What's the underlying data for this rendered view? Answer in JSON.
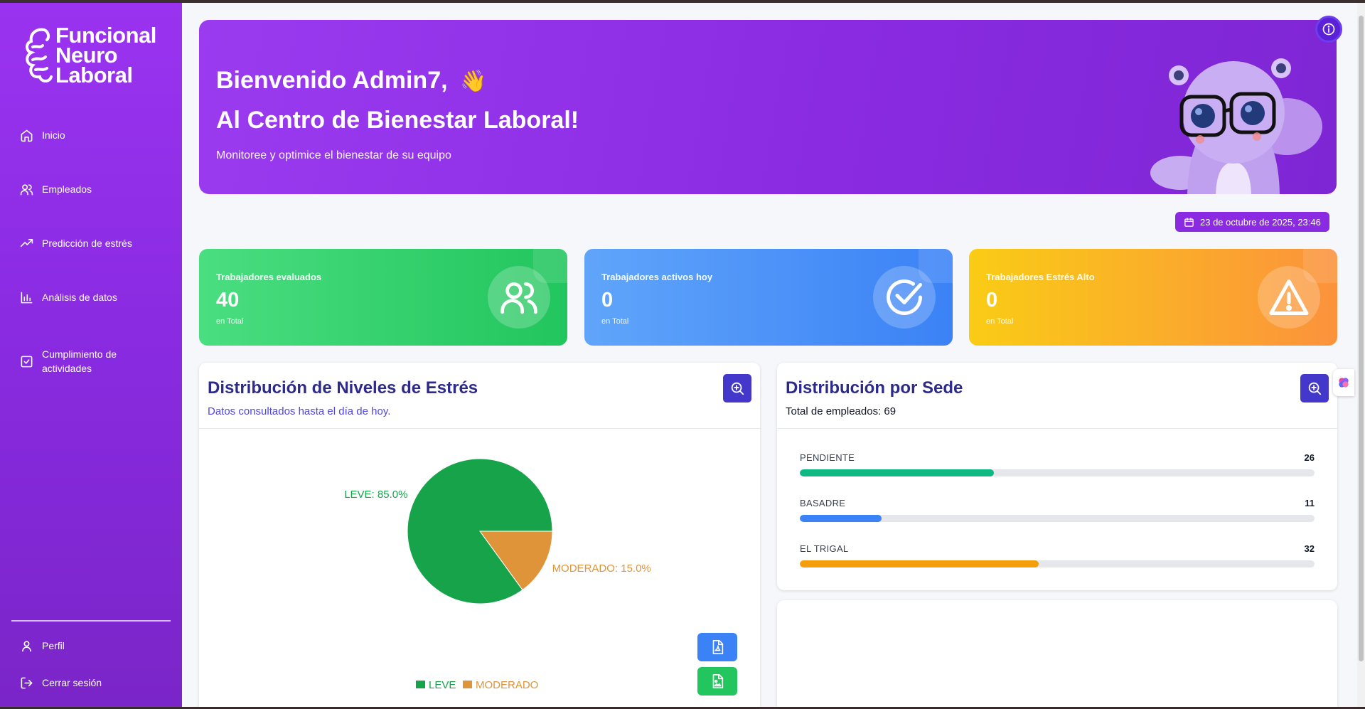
{
  "app": {
    "logo_lines": [
      "Funcional",
      "Neuro",
      "Laboral"
    ]
  },
  "sidebar": {
    "items": [
      {
        "label": "Inicio",
        "icon": "home-icon"
      },
      {
        "label": "Empleados",
        "icon": "users-icon"
      },
      {
        "label": "Predicción de estrés",
        "icon": "trending-up-icon"
      },
      {
        "label": "Análisis de datos",
        "icon": "bar-chart-icon"
      },
      {
        "label": "Cumplimiento de actividades",
        "icon": "check-square-icon"
      }
    ],
    "footer": [
      {
        "label": "Perfil",
        "icon": "user-icon"
      },
      {
        "label": "Cerrar sesión",
        "icon": "logout-icon"
      }
    ]
  },
  "hero": {
    "greeting": "Bienvenido Admin7,",
    "wave": "👋",
    "title": "Al Centro de Bienestar Laboral!",
    "subtitle": "Monitoree y optimice el bienestar de su equipo"
  },
  "date_badge": "23 de octubre de 2025, 23:46",
  "stats": [
    {
      "label": "Trabajadores evaluados",
      "value": "40",
      "caption": "en Total",
      "icon": "users-icon",
      "color": "#22c55e"
    },
    {
      "label": "Trabajadores activos hoy",
      "value": "0",
      "caption": "en Total",
      "icon": "check-circle-icon",
      "color": "#3b82f6"
    },
    {
      "label": "Trabajadores Estrés Alto",
      "value": "0",
      "caption": "en Total",
      "icon": "warning-icon",
      "color": "#fb923c"
    }
  ],
  "stress_card": {
    "title": "Distribución de Niveles de Estrés",
    "subtitle": "Datos consultados hasta el día de hoy."
  },
  "chart_data": {
    "type": "pie",
    "categories": [
      "LEVE",
      "MODERADO"
    ],
    "values": [
      85.0,
      15.0
    ],
    "slice_labels": [
      "LEVE: 85.0%",
      "MODERADO: 15.0%"
    ],
    "colors": [
      "#16a34a",
      "#e0943a"
    ],
    "legend": [
      "LEVE",
      "MODERADO"
    ],
    "legend_position": "bottom"
  },
  "sede_card": {
    "title": "Distribución por Sede",
    "subtitle": "Total de empleados: 69",
    "rows": [
      {
        "name": "PENDIENTE",
        "count": "26",
        "fraction": 0.377,
        "color": "#10b981"
      },
      {
        "name": "BASADRE",
        "count": "11",
        "fraction": 0.159,
        "color": "#3b82f6"
      },
      {
        "name": "EL TRIGAL",
        "count": "32",
        "fraction": 0.464,
        "color": "#f59e0b"
      }
    ]
  }
}
